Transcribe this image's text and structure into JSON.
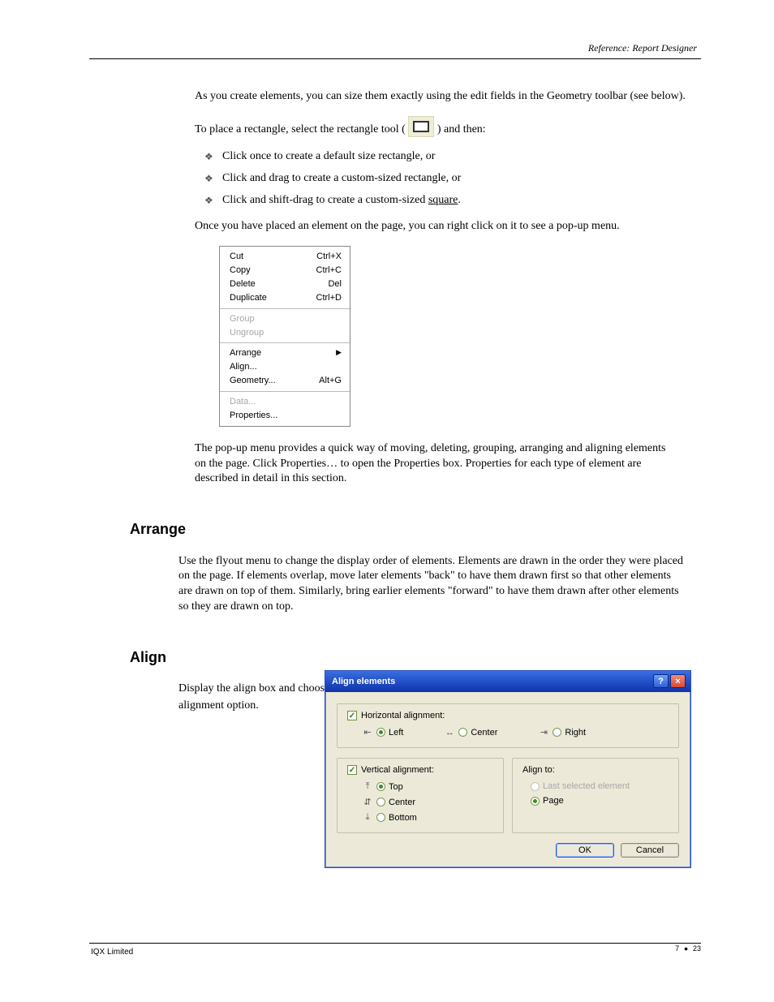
{
  "header": {
    "title": "Reference: Report Designer"
  },
  "content": {
    "p1": "As you create elements, you can size them exactly using the edit fields in the Geometry toolbar (see below).",
    "p2_pre": "To place a rectangle, select the rectangle tool (",
    "p2_post": ") and then:",
    "bullets": {
      "b1": "Click once to create a default size rectangle, or",
      "b2": "Click and drag to create a custom-sized rectangle, or",
      "b3": "Click and shift-drag to create a custom-sized square."
    },
    "p3": "Once you have placed an element on the page, you can right click on it to see a pop-up menu.",
    "context_menu": {
      "cut": {
        "label": "Cut",
        "accel": "Ctrl+X"
      },
      "copy": {
        "label": "Copy",
        "accel": "Ctrl+C"
      },
      "delete": {
        "label": "Delete",
        "accel": "Del"
      },
      "duplicate": {
        "label": "Duplicate",
        "accel": "Ctrl+D"
      },
      "group": {
        "label": "Group"
      },
      "ungroup": {
        "label": "Ungroup"
      },
      "arrange": {
        "label": "Arrange"
      },
      "align": {
        "label": "Align..."
      },
      "geometry": {
        "label": "Geometry...",
        "accel": "Alt+G"
      },
      "data": {
        "label": "Data..."
      },
      "properties": {
        "label": "Properties..."
      }
    },
    "p_after_menu": "The pop-up menu provides a quick way of moving, deleting, grouping, arranging and aligning elements on the page. Click Properties… to open the Properties box. Properties for each type of element are described in detail in this section.",
    "h_arrange": "Arrange",
    "p_arrange": "Use the flyout menu to change the display order of elements. Elements are drawn in the order they were placed on the page. If elements overlap, move later elements \"back\" to have them drawn first so that other elements are drawn on top of them. Similarly, bring earlier elements \"forward\" to have them drawn after other elements so they are drawn on top.",
    "h_align": "Align",
    "p_align": "Display the align box and choose an",
    "p_align2": "alignment option.",
    "dialog": {
      "title": "Align elements",
      "horizontal": {
        "chk_label": "Horizontal alignment:",
        "left": "Left",
        "center": "Center",
        "right": "Right"
      },
      "vertical": {
        "chk_label": "Vertical alignment:",
        "top": "Top",
        "center": "Center",
        "bottom": "Bottom"
      },
      "align_to": {
        "label": "Align to:",
        "last": "Last selected element",
        "page": "Page"
      },
      "ok": "OK",
      "cancel": "Cancel"
    }
  },
  "footer": {
    "left": "IQX Limited",
    "chapter": "7",
    "page": "23"
  }
}
